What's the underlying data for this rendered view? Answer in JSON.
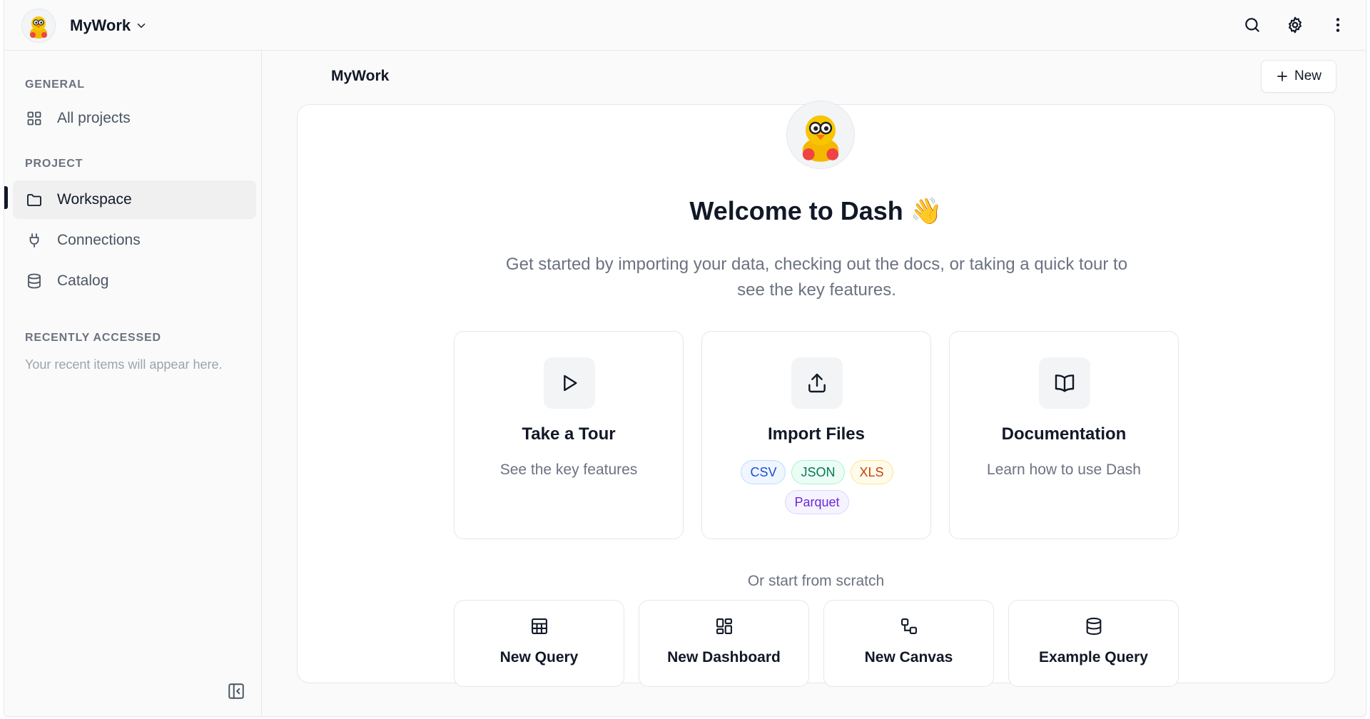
{
  "workspace": {
    "name": "MyWork"
  },
  "topbar": {
    "icons": [
      "search-icon",
      "gear-icon",
      "more-vertical-icon"
    ]
  },
  "sidebar": {
    "general_label": "GENERAL",
    "project_label": "PROJECT",
    "recent_label": "RECENTLY ACCESSED",
    "recent_empty": "Your recent items will appear here.",
    "items": [
      {
        "label": "All projects",
        "icon": "grid-icon"
      },
      {
        "label": "Workspace",
        "icon": "folder-icon",
        "active": true
      },
      {
        "label": "Connections",
        "icon": "plug-icon"
      },
      {
        "label": "Catalog",
        "icon": "database-icon"
      }
    ]
  },
  "main": {
    "title": "MyWork",
    "new_label": "New",
    "welcome_title": "Welcome to Dash 👋",
    "welcome_sub": "Get started by importing your data, checking out the docs, or taking a quick tour to see the key features.",
    "features": [
      {
        "title": "Take a Tour",
        "desc": "See the key features",
        "icon": "play-icon"
      },
      {
        "title": "Import Files",
        "icon": "upload-icon",
        "tags": [
          "CSV",
          "JSON",
          "XLS",
          "Parquet"
        ]
      },
      {
        "title": "Documentation",
        "desc": "Learn how to use Dash",
        "icon": "book-open-icon"
      }
    ],
    "scratch_label": "Or start from scratch",
    "scratch": [
      {
        "label": "New Query",
        "icon": "table-icon"
      },
      {
        "label": "New Dashboard",
        "icon": "dashboard-icon"
      },
      {
        "label": "New Canvas",
        "icon": "canvas-icon"
      },
      {
        "label": "Example Query",
        "icon": "database-icon"
      }
    ]
  },
  "colors": {
    "accent": "#111827",
    "muted_text": "#6b7280",
    "border": "#e5e7eb",
    "tag_csv": "#1d4ed8",
    "tag_json": "#047857",
    "tag_xls": "#c2410c",
    "tag_parquet": "#6d28d9"
  }
}
